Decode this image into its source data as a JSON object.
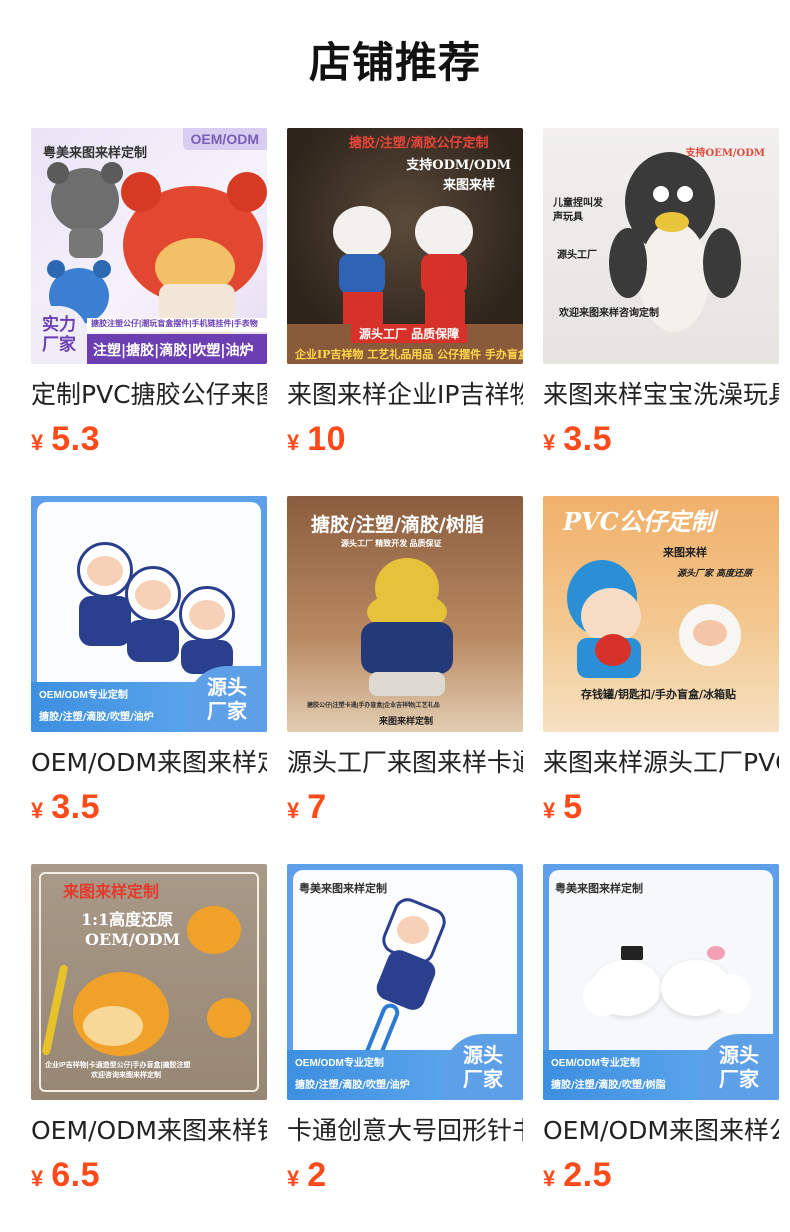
{
  "header": {
    "title": "店铺推荐"
  },
  "colors": {
    "price": "#ff4a1a",
    "accent_blue": "#3d8fe0"
  },
  "products": [
    {
      "title": "定制PVC搪胶公仔来图来样",
      "currency": "¥",
      "price": "5.3",
      "image": {
        "corner_tag": "OEM/ODM",
        "top_text": "粤美来图来样定制",
        "badge": "实力厂家",
        "strip_small": "搪胶注塑公仔|潮玩盲盒摆件|手机链挂件|手表物",
        "strip_main": "注塑|搪胶|滴胶|吹塑|油炉"
      }
    },
    {
      "title": "来图来样企业IP吉祥物定制",
      "currency": "¥",
      "price": "10",
      "image": {
        "top_text": "搪胶/注塑/滴胶公仔定制",
        "side_text_1": "支持ODM/ODM",
        "side_text_2": "来图来样",
        "bottom_banner": "源头工厂 品质保障",
        "bottom_text": "企业IP吉祥物 工艺礼品用品 公仔摆件 手办盲盒"
      }
    },
    {
      "title": "来图来样宝宝洗澡玩具定制",
      "currency": "¥",
      "price": "3.5",
      "image": {
        "corner_tag": "支持OEM/ODM",
        "left_text_1": "儿童捏叫发",
        "left_text_2": "声玩具",
        "left_text_3": "源头工厂",
        "bottom_text": "欢迎来图来样咨询定制"
      }
    },
    {
      "title": "OEM/ODM来图来样定制",
      "currency": "¥",
      "price": "3.5",
      "image": {
        "strip_small": "OEM/ODM专业定制",
        "strip_main": "搪胶/注塑/滴胶/吹塑/油炉",
        "badge": "源头厂家"
      }
    },
    {
      "title": "源头工厂来图来样卡通公仔",
      "currency": "¥",
      "price": "7",
      "image": {
        "top_text": "搪胶/注塑/滴胶/树脂",
        "sub_text": "源头工厂 精致开发 品质保证",
        "bottom_small": "搪胶公仔|注塑卡通|手办盲盒|企业吉祥物|工艺礼品",
        "bottom_text": "来图来样定制"
      }
    },
    {
      "title": "来图来样源头工厂PVC公仔",
      "currency": "¥",
      "price": "5",
      "image": {
        "top_text": "PVC公仔定制",
        "side_text_1": "来图来样",
        "side_text_2": "源头厂家 高度还原",
        "bottom_text": "存钱罐/钥匙扣/手办盲盒/冰箱贴"
      }
    },
    {
      "title": "OEM/ODM来图来样钥匙扣",
      "currency": "¥",
      "price": "6.5",
      "image": {
        "top_text": "来图来样定制",
        "mid_text_1": "1:1高度还原",
        "mid_text_2": "OEM/ODM",
        "bottom_text": "企业IP吉祥物|卡通造型公仔|手办盲盒|搪胶注塑",
        "bottom_text_2": "欢迎咨询来图来样定制"
      }
    },
    {
      "title": "卡通创意大号回形针书签",
      "currency": "¥",
      "price": "2",
      "image": {
        "top_text": "粤美来图来样定制",
        "strip_small": "OEM/ODM专业定制",
        "strip_main": "搪胶/注塑/滴胶/吹塑/油炉",
        "badge": "源头厂家"
      }
    },
    {
      "title": "OEM/ODM来图来样公仔",
      "currency": "¥",
      "price": "2.5",
      "image": {
        "top_text": "粤美来图来样定制",
        "strip_small": "OEM/ODM专业定制",
        "strip_main": "搪胶/注塑/滴胶/吹塑/树脂",
        "badge": "源头厂家"
      }
    }
  ]
}
